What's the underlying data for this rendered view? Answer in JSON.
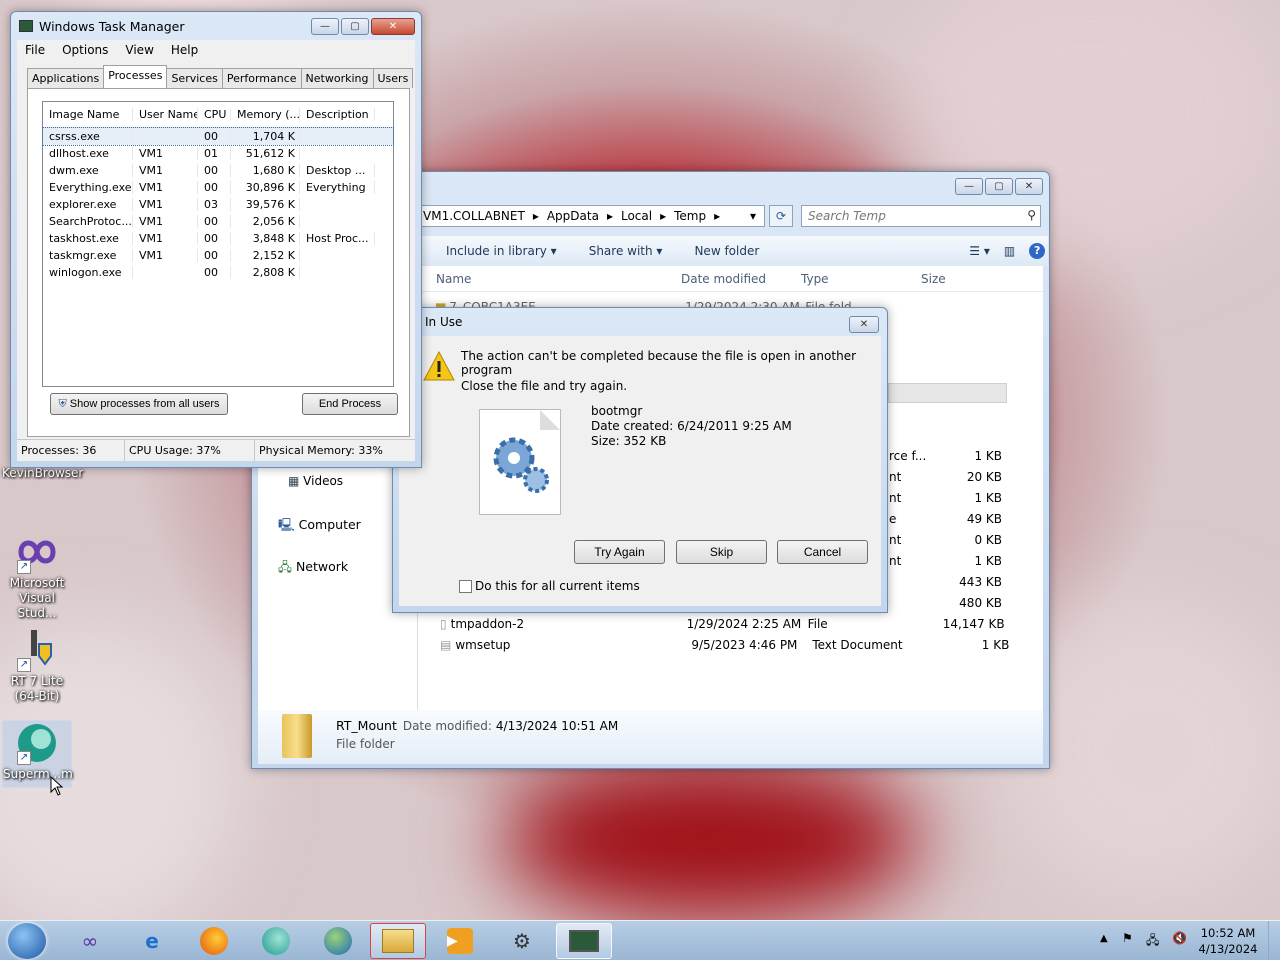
{
  "desktop": {
    "icons": [
      {
        "label": "KevinBrowser"
      },
      {
        "label": "Microsoft Visual Stud..."
      },
      {
        "label": "RT 7 Lite (64-Bit)"
      },
      {
        "label": "Superm...m"
      }
    ]
  },
  "taskmgr": {
    "title": "Windows Task Manager",
    "menu": [
      "File",
      "Options",
      "View",
      "Help"
    ],
    "tabs": [
      "Applications",
      "Processes",
      "Services",
      "Performance",
      "Networking",
      "Users"
    ],
    "columns": [
      "Image Name",
      "User Name",
      "CPU",
      "Memory (...",
      "Description"
    ],
    "rows": [
      {
        "name": "csrss.exe",
        "user": "",
        "cpu": "00",
        "mem": "1,704 K",
        "desc": ""
      },
      {
        "name": "dllhost.exe",
        "user": "VM1",
        "cpu": "01",
        "mem": "51,612 K",
        "desc": ""
      },
      {
        "name": "dwm.exe",
        "user": "VM1",
        "cpu": "00",
        "mem": "1,680 K",
        "desc": "Desktop ..."
      },
      {
        "name": "Everything.exe",
        "user": "VM1",
        "cpu": "00",
        "mem": "30,896 K",
        "desc": "Everything"
      },
      {
        "name": "explorer.exe",
        "user": "VM1",
        "cpu": "03",
        "mem": "39,576 K",
        "desc": ""
      },
      {
        "name": "SearchProtoc...",
        "user": "VM1",
        "cpu": "00",
        "mem": "2,056 K",
        "desc": ""
      },
      {
        "name": "taskhost.exe",
        "user": "VM1",
        "cpu": "00",
        "mem": "3,848 K",
        "desc": "Host Proc..."
      },
      {
        "name": "taskmgr.exe",
        "user": "VM1",
        "cpu": "00",
        "mem": "2,152 K",
        "desc": ""
      },
      {
        "name": "winlogon.exe",
        "user": "",
        "cpu": "00",
        "mem": "2,808 K",
        "desc": ""
      }
    ],
    "show_all_label": "Show processes from all users",
    "end_process_label": "End Process",
    "status": {
      "processes": "Processes: 36",
      "cpu": "CPU Usage: 37%",
      "memory": "Physical Memory: 33%"
    }
  },
  "explorer": {
    "breadcrumb": [
      "VM1.COLLABNET",
      "AppData",
      "Local",
      "Temp"
    ],
    "search_placeholder": "Search Temp",
    "toolbar": [
      "Include in library",
      "Share with",
      "New folder"
    ],
    "columns": [
      "Name",
      "Date modified",
      "Type",
      "Size"
    ],
    "partial_top_row": {
      "name": "7_COBC1A3EE",
      "date": "1/29/2024 2:30 AM",
      "type": "File fold..."
    },
    "partial_types": [
      "rce f...",
      "nt",
      "nt",
      "e",
      "nt",
      "nt"
    ],
    "sizes": [
      "1 KB",
      "20 KB",
      "1 KB",
      "49 KB",
      "0 KB",
      "1 KB",
      "443 KB",
      "480 KB"
    ],
    "rows": [
      {
        "name": "tmpaddon-2",
        "date": "1/29/2024 2:25 AM",
        "type": "File",
        "size": "14,147 KB"
      },
      {
        "name": "wmsetup",
        "date": "9/5/2023 4:46 PM",
        "type": "Text Document",
        "size": "1 KB"
      }
    ],
    "nav": [
      "Videos",
      "Computer",
      "Network"
    ],
    "details": {
      "name": "RT_Mount",
      "date_label": "Date modified:",
      "date": "4/13/2024 10:51 AM",
      "type": "File folder"
    }
  },
  "dialog": {
    "title": "In Use",
    "message": "The action can't be completed because the file is open in another program",
    "sub": "Close the file and try again.",
    "file_name": "bootmgr",
    "created": "Date created: 6/24/2011 9:25 AM",
    "size": "Size: 352 KB",
    "try_again": "Try Again",
    "skip": "Skip",
    "cancel": "Cancel",
    "checkbox_label": "Do this for all current items"
  },
  "clock": {
    "time": "10:52 AM",
    "date": "4/13/2024"
  }
}
